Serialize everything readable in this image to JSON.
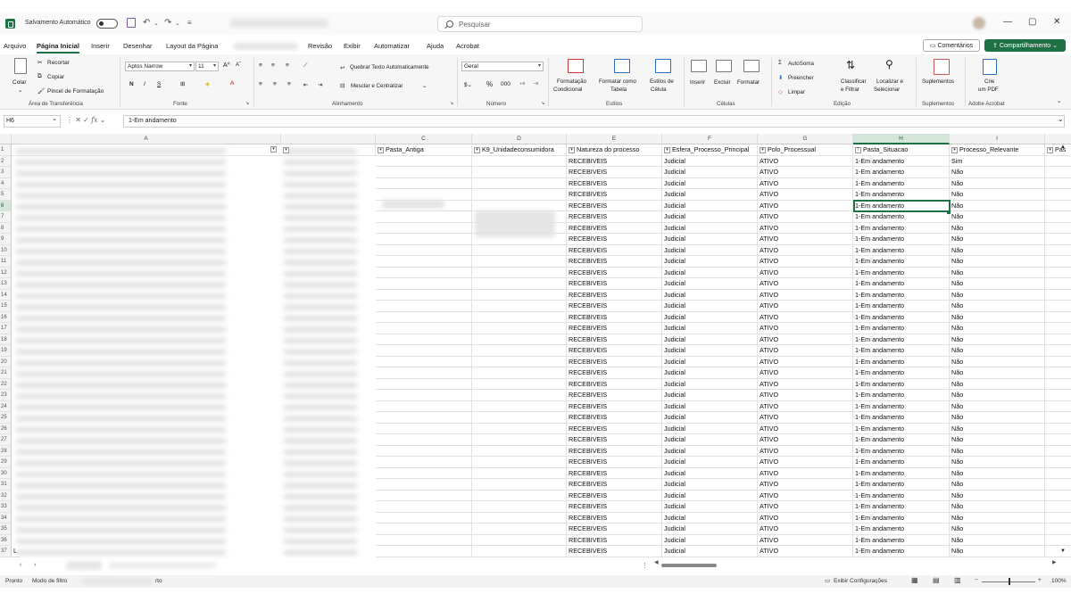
{
  "titlebar": {
    "autosave_label": "Salvamento Automático",
    "search_placeholder": "Pesquisar"
  },
  "menu": {
    "items": [
      "Arquivo",
      "Página Inicial",
      "Inserir",
      "Desenhar",
      "Layout da Página",
      "Revisão",
      "Exibir",
      "Automatizar",
      "Ajuda",
      "Acrobat"
    ],
    "comments": "Comentários",
    "share": "Compartilhamento"
  },
  "ribbon": {
    "colar": "Colar",
    "recortar": "Recortar",
    "copiar": "Copiar",
    "pincel": "Pincel de Formatação",
    "area_transfer": "Área de Transferência",
    "font_name": "Aptos Narrow",
    "font_size": "11",
    "bold": "N",
    "italic": "I",
    "underline": "S",
    "fonte": "Fonte",
    "quebrar": "Quebrar Texto Automaticamente",
    "mesclar": "Mesclar e Centralizar",
    "alinhamento": "Alinhamento",
    "num_format": "Geral",
    "numero": "Número",
    "cond_format": [
      "Formatação",
      "Condicional"
    ],
    "table_format": [
      "Formatar como",
      "Tabela"
    ],
    "cell_styles": [
      "Estilos de",
      "Célula"
    ],
    "estilos": "Estilos",
    "inserir": "Inserir",
    "excluir": "Excluir",
    "formatar": "Formatar",
    "celulas": "Células",
    "autosoma": "AutoSoma",
    "preencher": "Preencher",
    "limpar": "Limpar",
    "classificar": [
      "Classificar",
      "e Filtrar"
    ],
    "localizar": [
      "Localizar e",
      "Selecionar"
    ],
    "edicao": "Edição",
    "suplementos": "Suplementos",
    "crie_pdf": [
      "Crie",
      "um PDF"
    ],
    "adobe": "Adobe Acrobat"
  },
  "formula": {
    "namebox": "H6",
    "content": "1-Em andamento"
  },
  "columns": [
    "A",
    "",
    "C",
    "D",
    "E",
    "F",
    "G",
    "H",
    "I"
  ],
  "headers": {
    "c": "Pasta_Antiga",
    "d": "K9_Unidadeconsumidora",
    "e": "Natureza do processo",
    "f": "Esfera_Processo_Principal",
    "g": "Polo_Processual",
    "h": "Pasta_Situacao",
    "i": "Processo_Relevante",
    "j": "Pas"
  },
  "rows": {
    "numbers": [
      "1",
      "2",
      "3",
      "4",
      "5",
      "6",
      "7",
      "8",
      "9",
      "10",
      "11",
      "12",
      "13",
      "14",
      "15",
      "16",
      "17",
      "18",
      "19",
      "20",
      "21",
      "22",
      "23",
      "24",
      "25",
      "26",
      "27",
      "28",
      "29",
      "30",
      "31",
      "32",
      "33",
      "34",
      "35",
      "36",
      "37"
    ],
    "natureza": "RECEBIVEIS",
    "esfera": "Judicial",
    "polo": "ATIVO",
    "situacao": "1-Em andamento",
    "relevante_first": "Sim",
    "relevante_rest": "Não",
    "row37_a": "L"
  },
  "status": {
    "ready": "Pronto",
    "filter_mode": "Modo de filtro",
    "accessibility_suffix": "rto",
    "display_settings": "Exibir Configurações",
    "zoom": "100%"
  }
}
